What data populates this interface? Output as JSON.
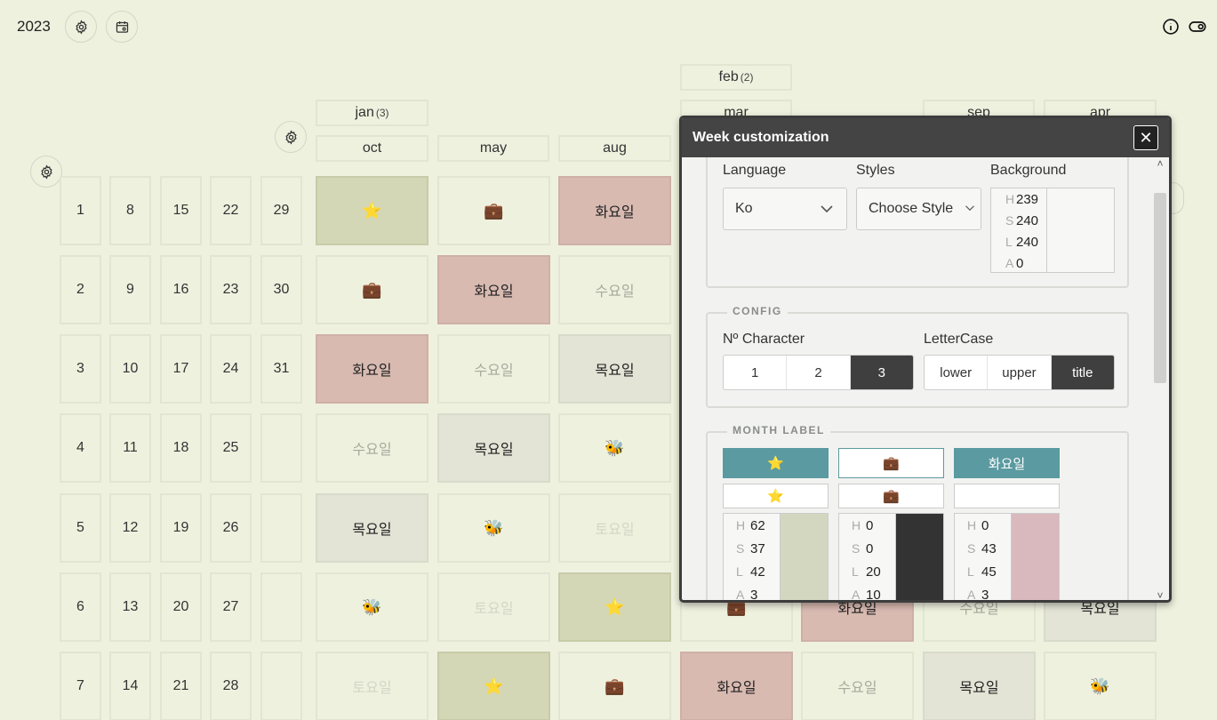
{
  "topbar": {
    "year": "2023",
    "settings_icon": "gear-icon",
    "calendar_icon": "calendar-settings-icon",
    "info_icon": "info-icon",
    "toggle_icon": "toggle-icon"
  },
  "day_columns": [
    [
      "1",
      "2",
      "3",
      "4",
      "5",
      "6",
      "7"
    ],
    [
      "8",
      "9",
      "10",
      "11",
      "12",
      "13",
      "14"
    ],
    [
      "15",
      "16",
      "17",
      "18",
      "19",
      "20",
      "21"
    ],
    [
      "22",
      "23",
      "24",
      "25",
      "26",
      "27",
      "28"
    ],
    [
      "29",
      "30",
      "31",
      "",
      "",
      "",
      ""
    ]
  ],
  "month_labels": {
    "feb": "feb",
    "feb_count": "(2)",
    "jan": "jan",
    "jan_count": "(3)",
    "mar": "mar",
    "sep": "sep",
    "apr": "apr",
    "oct": "oct",
    "may": "may",
    "aug": "aug"
  },
  "weekday_labels": {
    "tue": "화요일",
    "wed": "수요일",
    "thu": "목요일",
    "sat": "토요일"
  },
  "modal": {
    "title": "Week customization",
    "close": "✕",
    "language_label": "Language",
    "language_value": "Ko",
    "styles_label": "Styles",
    "styles_value": "Choose Style",
    "background_label": "Background",
    "background": {
      "h": "239",
      "s": "240",
      "l": "240",
      "a": "0",
      "color": "#f7f7f6"
    },
    "hsla_keys": {
      "h": "H",
      "s": "S",
      "l": "L",
      "a": "A"
    },
    "config_legend": "CONFIG",
    "nchar_label": "Nº Character",
    "nchar_options": [
      "1",
      "2",
      "3"
    ],
    "nchar_selected": "3",
    "lettercase_label": "LetterCase",
    "lettercase_options": [
      "lower",
      "upper",
      "title"
    ],
    "lettercase_selected": "title",
    "month_label_legend": "MONTH LABEL",
    "month_label_items": [
      {
        "button": "⭐",
        "preview": "⭐",
        "h": "62",
        "s": "37",
        "l": "42",
        "a": "3",
        "color": "#d4d7c0"
      },
      {
        "button": "💼",
        "preview": "💼",
        "h": "0",
        "s": "0",
        "l": "20",
        "a": "10",
        "color": "#333333"
      },
      {
        "button": "화요일",
        "preview": "",
        "h": "0",
        "s": "43",
        "l": "45",
        "a": "3",
        "color": "#d9b9bd"
      }
    ]
  }
}
